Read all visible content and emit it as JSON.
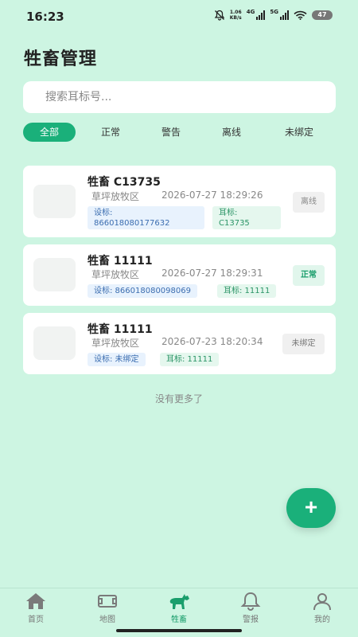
{
  "status_bar": {
    "time": "16:23",
    "net_speed_value": "1.06",
    "net_speed_unit": "KB/s",
    "net_type_1": "4G",
    "net_type_2": "5G",
    "battery": "47"
  },
  "page": {
    "title": "牲畜管理"
  },
  "search": {
    "placeholder": "搜索耳标号..."
  },
  "filters": [
    {
      "label": "全部",
      "active": true
    },
    {
      "label": "正常"
    },
    {
      "label": "警告"
    },
    {
      "label": "离线"
    },
    {
      "label": "未绑定"
    }
  ],
  "livestock": [
    {
      "name": "牲畜 C13735",
      "place": "草坪放牧区",
      "time": "2026-07-27 18:29:26",
      "device_label": "设标:",
      "device_value": "866018080177632",
      "ear_label": "耳标:",
      "ear_value": "C13735",
      "status": "离线"
    },
    {
      "name": "牲畜 11111",
      "place": "草坪放牧区",
      "time": "2026-07-27 18:29:31",
      "device_tag": "设标: 866018080098069",
      "ear_tag": "耳标: 11111",
      "status": "正常"
    },
    {
      "name": "牲畜 11111",
      "place": "草坪放牧区",
      "time": "2026-07-23 18:20:34",
      "device_tag": "设标: 未绑定",
      "ear_tag": "耳标: 11111",
      "status": "未绑定"
    }
  ],
  "list_footer": "没有更多了",
  "fab": {
    "label": "+"
  },
  "bottom_nav": [
    {
      "label": "首页",
      "icon": "home-icon"
    },
    {
      "label": "地图",
      "icon": "map-icon"
    },
    {
      "label": "牲畜",
      "icon": "horse-icon",
      "active": true
    },
    {
      "label": "警报",
      "icon": "bell-icon"
    },
    {
      "label": "我的",
      "icon": "user-icon"
    }
  ],
  "colors": {
    "accent": "#1ab07a",
    "background": "#cdf5e2"
  }
}
